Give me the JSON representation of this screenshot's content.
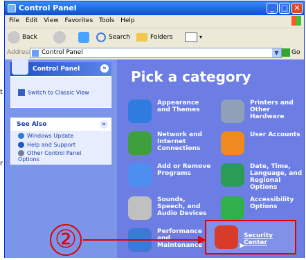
{
  "window": {
    "title": "Control Panel"
  },
  "menu": [
    "File",
    "Edit",
    "View",
    "Favorites",
    "Tools",
    "Help"
  ],
  "toolbar": {
    "back": "Back",
    "search": "Search",
    "folders": "Folders"
  },
  "address": {
    "label": "Address",
    "value": "Control Panel",
    "go": "Go"
  },
  "left_pane": {
    "panel_title": "Control Panel",
    "switch_link": "Switch to Classic View",
    "see_also_title": "See Also",
    "see_also": [
      "Windows Update",
      "Help and Support",
      "Other Control Panel Options"
    ]
  },
  "main": {
    "heading": "Pick a category",
    "categories": [
      {
        "label": "Appearance and Themes",
        "color": "#2f7ce0"
      },
      {
        "label": "Printers and Other Hardware",
        "color": "#8fa0b8"
      },
      {
        "label": "Network and Internet Connections",
        "color": "#3da03d"
      },
      {
        "label": "User Accounts",
        "color": "#f08a1f"
      },
      {
        "label": "Add or Remove Programs",
        "color": "#4d8ef0"
      },
      {
        "label": "Date, Time, Language, and Regional Options",
        "color": "#2b9c54"
      },
      {
        "label": "Sounds, Speech, and Audio Devices",
        "color": "#c0c0c0"
      },
      {
        "label": "Accessibility Options",
        "color": "#2fb04b"
      },
      {
        "label": "Performance and Maintenance",
        "color": "#3c79d8"
      },
      {
        "label": "Security Center",
        "color": "#d83b2a"
      }
    ]
  },
  "annotation": {
    "number": "②"
  },
  "outside": {
    "left_fragment_1": "t",
    "left_fragment_2": "r"
  }
}
